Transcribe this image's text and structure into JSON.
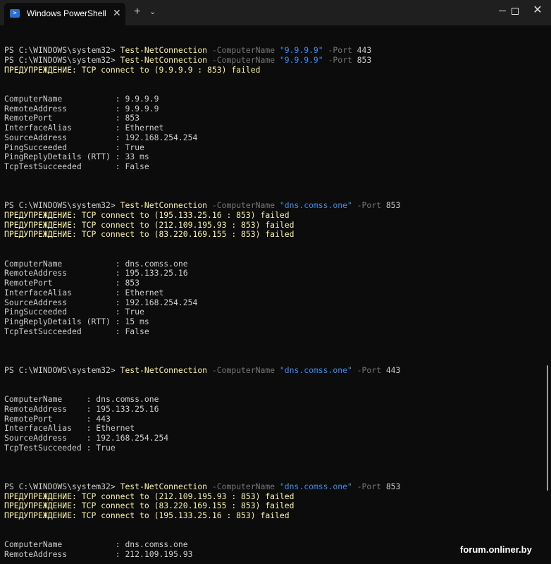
{
  "window": {
    "tab_title": "Windows PowerShell",
    "tab_icon": "powershell-icon",
    "close_tab": "✕",
    "new_tab": "+",
    "dropdown": "⌄",
    "minimize_icon": "minimize-icon",
    "maximize_icon": "maximize-icon",
    "close_icon": "close-icon",
    "close_glyph": "✕"
  },
  "colors": {
    "background": "#0c0c0c",
    "titlebar": "#1f1f1f",
    "command": "#f9f1a5",
    "parameter": "#767676",
    "string": "#3b8eea",
    "warning": "#f9f1a5",
    "text": "#cccccc"
  },
  "terminal": {
    "lines": [
      {
        "type": "cmd",
        "prompt": "PS C:\\WINDOWS\\system32> ",
        "cmd": "Test-NetConnection",
        "p1": " -ComputerName ",
        "host": "\"9.9.9.9\"",
        "p2": " -Port ",
        "port": "443"
      },
      {
        "type": "cmd",
        "prompt": "PS C:\\WINDOWS\\system32> ",
        "cmd": "Test-NetConnection",
        "p1": " -ComputerName ",
        "host": "\"9.9.9.9\"",
        "p2": " -Port ",
        "port": "853"
      },
      {
        "type": "warn",
        "text": "ПРЕДУПРЕЖДЕНИЕ: TCP connect to (9.9.9.9 : 853) failed"
      },
      {
        "type": "blank"
      },
      {
        "type": "blank"
      },
      {
        "type": "out",
        "text": "ComputerName           : 9.9.9.9"
      },
      {
        "type": "out",
        "text": "RemoteAddress          : 9.9.9.9"
      },
      {
        "type": "out",
        "text": "RemotePort             : 853"
      },
      {
        "type": "out",
        "text": "InterfaceAlias         : Ethernet"
      },
      {
        "type": "out",
        "text": "SourceAddress          : 192.168.254.254"
      },
      {
        "type": "out",
        "text": "PingSucceeded          : True"
      },
      {
        "type": "out",
        "text": "PingReplyDetails (RTT) : 33 ms"
      },
      {
        "type": "out",
        "text": "TcpTestSucceeded       : False"
      },
      {
        "type": "blank"
      },
      {
        "type": "blank"
      },
      {
        "type": "blank"
      },
      {
        "type": "cmd",
        "prompt": "PS C:\\WINDOWS\\system32> ",
        "cmd": "Test-NetConnection",
        "p1": " -ComputerName ",
        "host": "\"dns.comss.one\"",
        "p2": " -Port ",
        "port": "853"
      },
      {
        "type": "warn",
        "text": "ПРЕДУПРЕЖДЕНИЕ: TCP connect to (195.133.25.16 : 853) failed"
      },
      {
        "type": "warn",
        "text": "ПРЕДУПРЕЖДЕНИЕ: TCP connect to (212.109.195.93 : 853) failed"
      },
      {
        "type": "warn",
        "text": "ПРЕДУПРЕЖДЕНИЕ: TCP connect to (83.220.169.155 : 853) failed"
      },
      {
        "type": "blank"
      },
      {
        "type": "blank"
      },
      {
        "type": "out",
        "text": "ComputerName           : dns.comss.one"
      },
      {
        "type": "out",
        "text": "RemoteAddress          : 195.133.25.16"
      },
      {
        "type": "out",
        "text": "RemotePort             : 853"
      },
      {
        "type": "out",
        "text": "InterfaceAlias         : Ethernet"
      },
      {
        "type": "out",
        "text": "SourceAddress          : 192.168.254.254"
      },
      {
        "type": "out",
        "text": "PingSucceeded          : True"
      },
      {
        "type": "out",
        "text": "PingReplyDetails (RTT) : 15 ms"
      },
      {
        "type": "out",
        "text": "TcpTestSucceeded       : False"
      },
      {
        "type": "blank"
      },
      {
        "type": "blank"
      },
      {
        "type": "blank"
      },
      {
        "type": "cmd",
        "prompt": "PS C:\\WINDOWS\\system32> ",
        "cmd": "Test-NetConnection",
        "p1": " -ComputerName ",
        "host": "\"dns.comss.one\"",
        "p2": " -Port ",
        "port": "443"
      },
      {
        "type": "blank"
      },
      {
        "type": "blank"
      },
      {
        "type": "out",
        "text": "ComputerName     : dns.comss.one"
      },
      {
        "type": "out",
        "text": "RemoteAddress    : 195.133.25.16"
      },
      {
        "type": "out",
        "text": "RemotePort       : 443"
      },
      {
        "type": "out",
        "text": "InterfaceAlias   : Ethernet"
      },
      {
        "type": "out",
        "text": "SourceAddress    : 192.168.254.254"
      },
      {
        "type": "out",
        "text": "TcpTestSucceeded : True"
      },
      {
        "type": "blank"
      },
      {
        "type": "blank"
      },
      {
        "type": "blank"
      },
      {
        "type": "cmd",
        "prompt": "PS C:\\WINDOWS\\system32> ",
        "cmd": "Test-NetConnection",
        "p1": " -ComputerName ",
        "host": "\"dns.comss.one\"",
        "p2": " -Port ",
        "port": "853"
      },
      {
        "type": "warn",
        "text": "ПРЕДУПРЕЖДЕНИЕ: TCP connect to (212.109.195.93 : 853) failed"
      },
      {
        "type": "warn",
        "text": "ПРЕДУПРЕЖДЕНИЕ: TCP connect to (83.220.169.155 : 853) failed"
      },
      {
        "type": "warn",
        "text": "ПРЕДУПРЕЖДЕНИЕ: TCP connect to (195.133.25.16 : 853) failed"
      },
      {
        "type": "blank"
      },
      {
        "type": "blank"
      },
      {
        "type": "out",
        "text": "ComputerName           : dns.comss.one"
      },
      {
        "type": "out",
        "text": "RemoteAddress          : 212.109.195.93"
      }
    ]
  },
  "watermark": "forum.onliner.by"
}
